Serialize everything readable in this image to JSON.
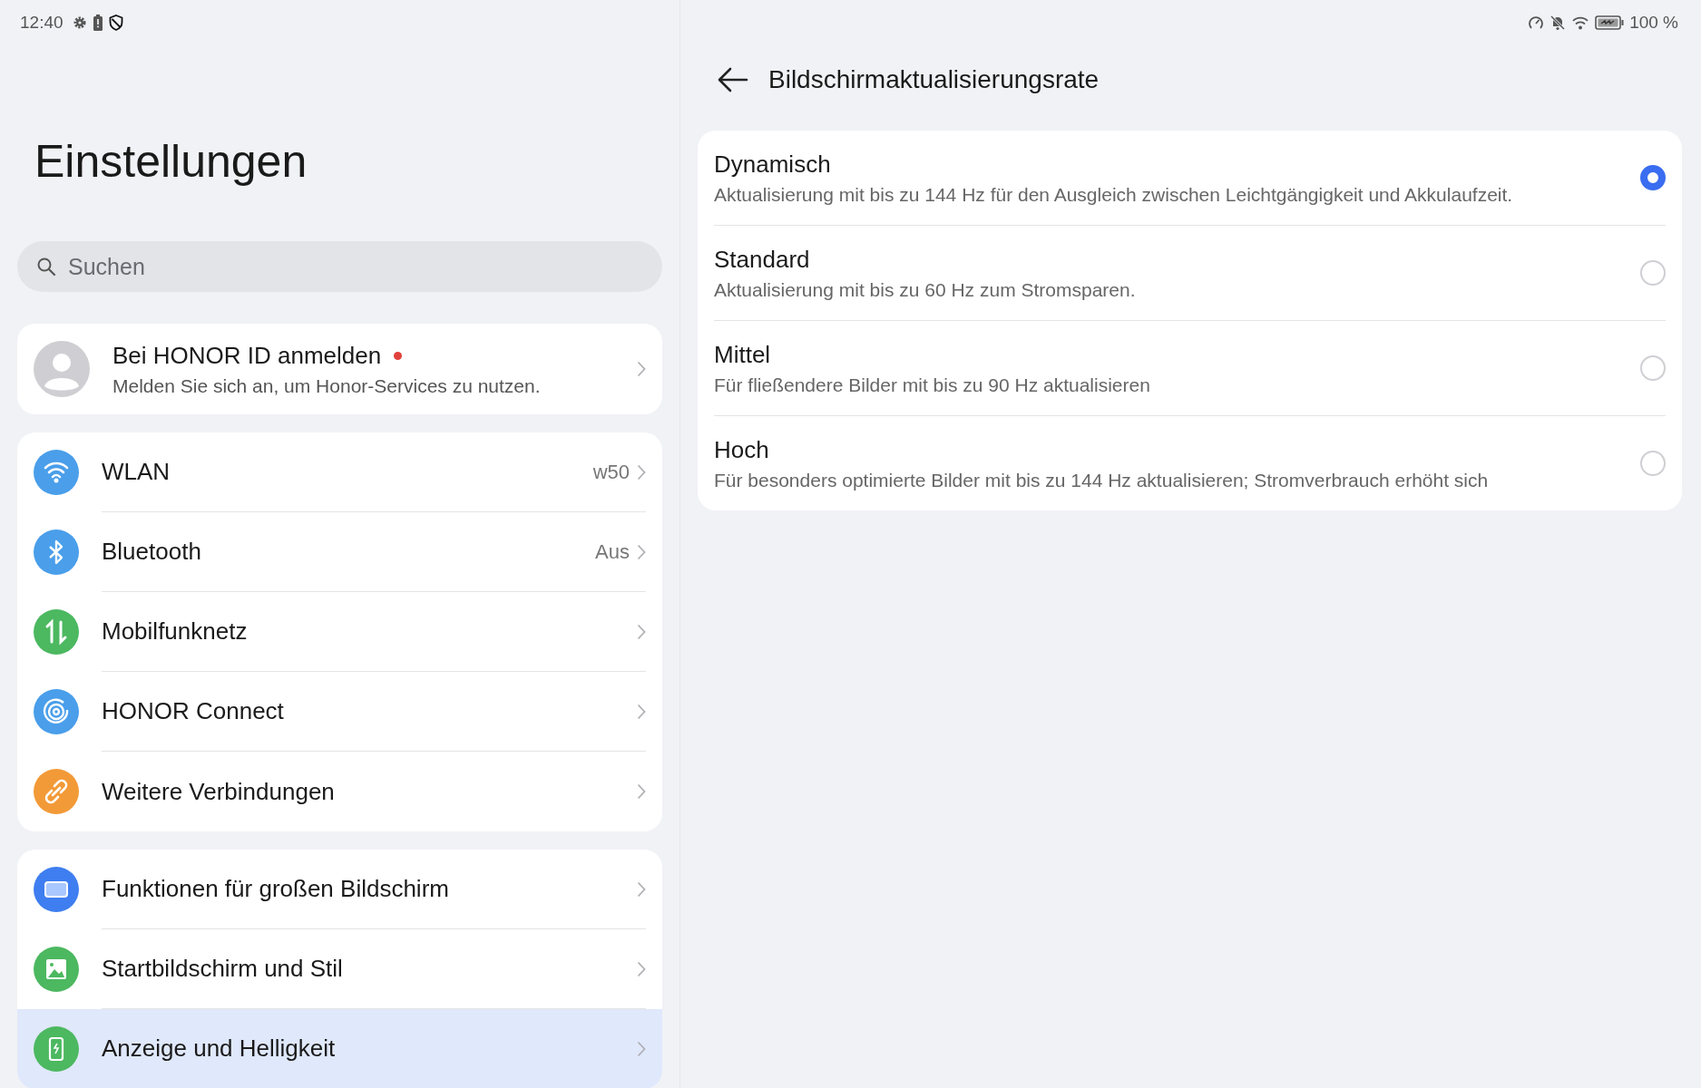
{
  "status_bar": {
    "time": "12:40",
    "battery": "100 %"
  },
  "sidebar": {
    "title": "Einstellungen",
    "search": {
      "placeholder": "Suchen"
    },
    "account": {
      "title": "Bei HONOR ID anmelden",
      "subtitle": "Melden Sie sich an, um Honor-Services zu nutzen.",
      "notification_dot": true
    },
    "groups": [
      {
        "items": [
          {
            "kind": "wifi",
            "label": "WLAN",
            "value": "w50",
            "color": "#4a9eea",
            "selected": false
          },
          {
            "kind": "bluetooth",
            "label": "Bluetooth",
            "value": "Aus",
            "color": "#4a9eea",
            "selected": false
          },
          {
            "kind": "mobile-data",
            "label": "Mobilfunknetz",
            "color": "#4cb860",
            "selected": false
          },
          {
            "kind": "connect",
            "label": "HONOR Connect",
            "color": "#4a9eea",
            "selected": false
          },
          {
            "kind": "link",
            "label": "Weitere Verbindungen",
            "color": "#f29a38",
            "selected": false
          }
        ]
      },
      {
        "items": [
          {
            "kind": "screen",
            "label": "Funktionen für großen Bildschirm",
            "color": "#3f7ef0",
            "selected": false
          },
          {
            "kind": "image",
            "label": "Startbildschirm und Stil",
            "color": "#4cb860",
            "selected": false
          },
          {
            "kind": "display",
            "label": "Anzeige und Helligkeit",
            "color": "#4cb860",
            "selected": true
          }
        ]
      }
    ]
  },
  "detail": {
    "title": "Bildschirmaktualisierungsrate",
    "options": [
      {
        "title": "Dynamisch",
        "description": "Aktualisierung mit bis zu 144 Hz für den Ausgleich zwischen Leichtgängigkeit und Akkulaufzeit.",
        "selected": true
      },
      {
        "title": "Standard",
        "description": "Aktualisierung mit bis zu 60 Hz zum Stromsparen.",
        "selected": false
      },
      {
        "title": "Mittel",
        "description": "Für fließendere Bilder mit bis zu 90 Hz aktualisieren",
        "selected": false
      },
      {
        "title": "Hoch",
        "description": "Für besonders optimierte Bilder mit bis zu 144 Hz aktualisieren; Stromverbrauch erhöht sich",
        "selected": false
      }
    ]
  }
}
